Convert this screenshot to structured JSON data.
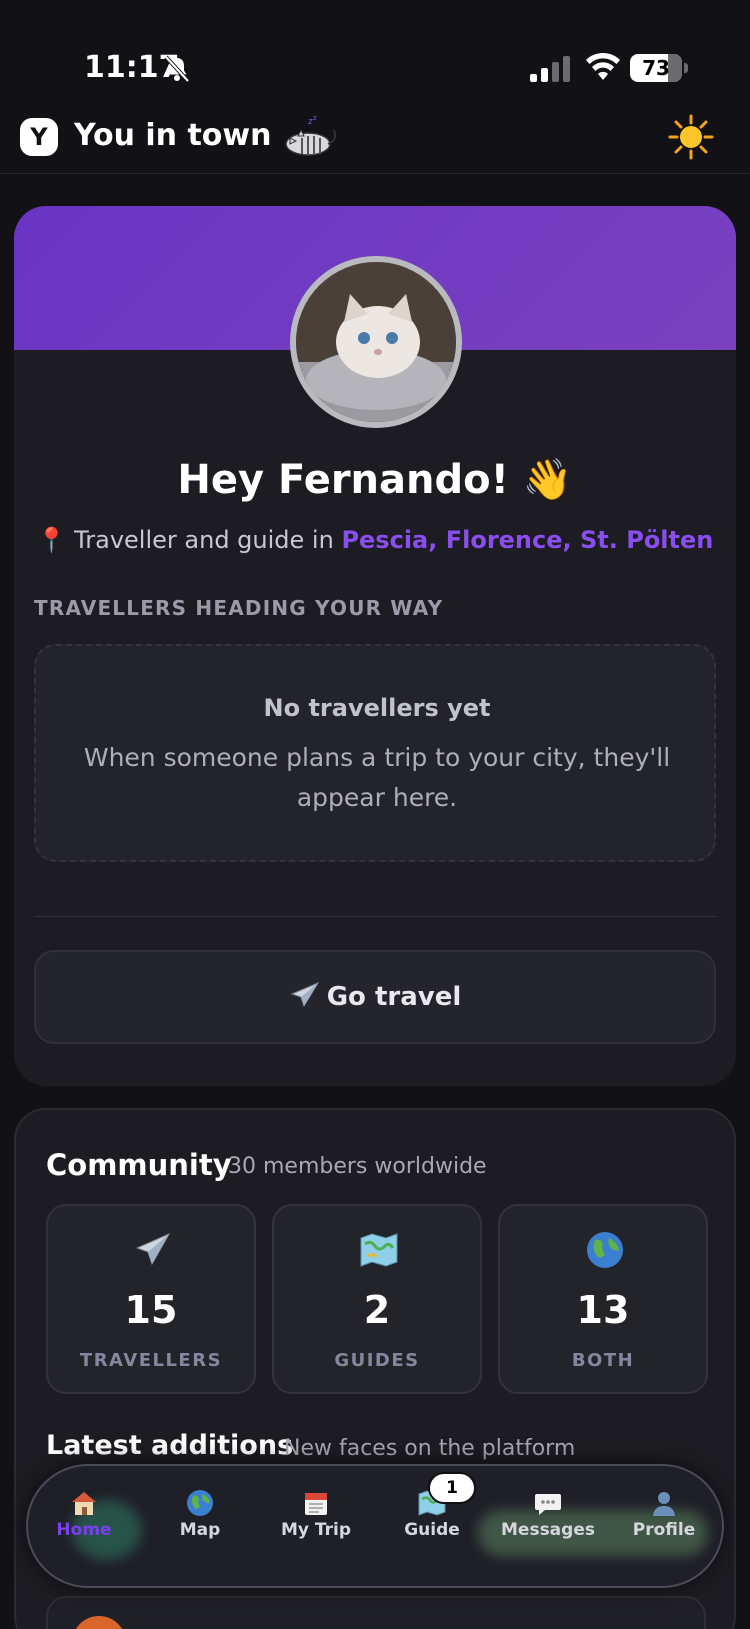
{
  "status_bar": {
    "time": "11:17",
    "battery_percent": "73",
    "battery_level": 0.73,
    "icons": [
      "bell-slash-icon",
      "signal-icon",
      "wifi-icon",
      "battery-icon"
    ]
  },
  "header": {
    "title": "You in town",
    "logo_letter": "Y",
    "icons": [
      "logo-icon",
      "sleeping-cat-icon",
      "sun-icon"
    ]
  },
  "profile": {
    "greeting": "Hey Fernando! 👋",
    "location_prefix": "📍 Traveller and guide in ",
    "location_cities": "Pescia, Florence, St. Pölten",
    "banner_color": "#6a34c4",
    "accent_color": "#8a4ef0"
  },
  "travellers_section": {
    "heading": "TRAVELLERS HEADING YOUR WAY",
    "empty_title": "No travellers yet",
    "empty_description": "When someone plans a trip to your city, they'll appear here."
  },
  "actions": {
    "go_travel_label": "Go travel"
  },
  "community": {
    "title": "Community",
    "subtitle": "30 members worldwide",
    "stats": [
      {
        "icon": "airplane-icon",
        "value": "15",
        "label": "TRAVELLERS"
      },
      {
        "icon": "map-icon",
        "value": "2",
        "label": "GUIDES"
      },
      {
        "icon": "globe-icon",
        "value": "13",
        "label": "BOTH"
      }
    ]
  },
  "latest": {
    "title": "Latest additions",
    "subtitle": "New faces on the platform"
  },
  "bottom_nav": {
    "items": [
      {
        "label": "Home",
        "icon": "house-icon",
        "active": true
      },
      {
        "label": "Map",
        "icon": "globe-icon"
      },
      {
        "label": "My Trip",
        "icon": "calendar-icon"
      },
      {
        "label": "Guide",
        "icon": "map-icon"
      },
      {
        "label": "Messages",
        "icon": "speech-bubble-icon"
      },
      {
        "label": "Profile",
        "icon": "person-icon"
      }
    ],
    "guide_badge": "1"
  }
}
